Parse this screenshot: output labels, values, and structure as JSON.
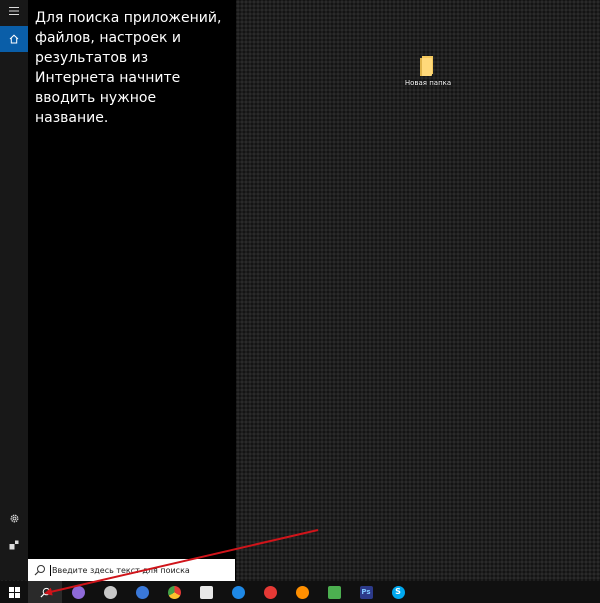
{
  "desktop": {
    "icons": [
      {
        "label": "Новая папка",
        "icon": "folder-icon"
      }
    ]
  },
  "start_panel": {
    "hint_text": "Для поиска приложений, файлов, настроек и результатов из Интернета начните вводить нужное название.",
    "rail": {
      "icons": [
        "hamburger-menu-icon",
        "home-icon",
        "gear-icon",
        "user-icon"
      ],
      "active": "home-icon",
      "active_color": "#0a5ea8"
    }
  },
  "search": {
    "placeholder": "Введите здесь текст для поиска"
  },
  "taskbar": {
    "start_icon": "windows-logo-icon",
    "search_icon": "search-icon",
    "apps": [
      {
        "name": "cortana-icon",
        "color": "#8e6ad8"
      },
      {
        "name": "yandex-browser-icon",
        "color": "#c8c8c8"
      },
      {
        "name": "launcher-icon",
        "color": "#3a78d8"
      },
      {
        "name": "chrome-icon",
        "color": "#4caf50"
      },
      {
        "name": "store-icon",
        "color": "#e8e8e8"
      },
      {
        "name": "edge-icon",
        "color": "#1e88e5"
      },
      {
        "name": "opera-icon",
        "color": "#e53935"
      },
      {
        "name": "firefox-icon",
        "color": "#ff8f00"
      },
      {
        "name": "calculator-icon",
        "color": "#4caf50"
      },
      {
        "name": "photoshop-icon",
        "color": "#2c3a8a",
        "text": "Ps"
      },
      {
        "name": "skype-icon",
        "color": "#00a9f0",
        "text": "S"
      }
    ]
  },
  "annotation": {
    "color": "#d0141a"
  }
}
